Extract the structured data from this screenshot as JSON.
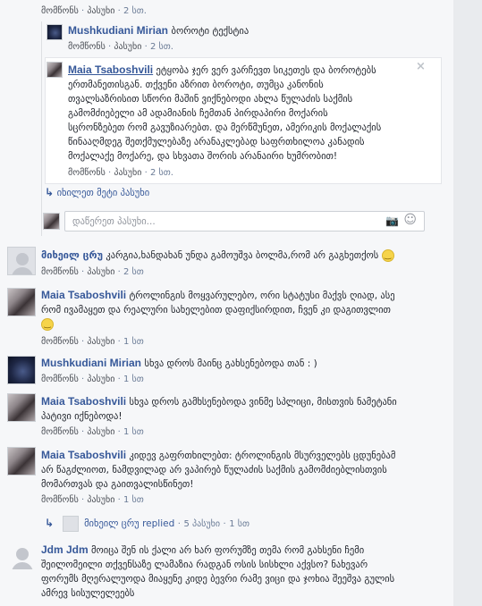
{
  "common": {
    "like": "მომწონს",
    "reply": "პასუხი",
    "dot": "·"
  },
  "top_meta": {
    "time": "2 სთ."
  },
  "reply1": {
    "author": "Mushkudiani Mirian",
    "text": "ბოროტი ტექსტია",
    "time": "2 სთ."
  },
  "reply2": {
    "author": "Maia Tsaboshvili",
    "text": [
      "ეტყობა ჯერ ვერ ვარჩევთ სიკეთეს და ბოროტებს",
      "ერთმანეთისგან. თქვენი აზრით ბოროტი, თუმცა კანონის",
      "თვალსაზრისით სწორი მაშინ ვიქნებოდი ახლა წულაძის საქმის",
      "გამომძიებელი ამ ადამიანის ჩემთან პირდაპირი მოქარის",
      "სცრონზებეთ რომ გავუზიარებთ. და მერწმუნეთ, ამერიკის მოქალაქის",
      "წინააღმდეგ შეთქმულებაზე არანაკლებად საფრთხილოა კანადის",
      "მოქალაქე მოქარე, და სხვათა შორის არანაირი ხუმრობით!"
    ],
    "close": "×",
    "time": "2 სთ."
  },
  "more_replies": "იხილეთ მეტი პასუხი",
  "reply_input": {
    "placeholder": "დაწერეთ პასუხი...",
    "camera": "📷",
    "smile": "☺"
  },
  "c1": {
    "author": "მიხეილ ცრუ",
    "text": [
      "კარგია,ხანდახან უნდა გამოუშვა ბოლმა,რომ არ გაგხეთქოს"
    ],
    "time": "2 სთ"
  },
  "c2": {
    "author": "Maia Tsaboshvili",
    "text": [
      "ტროლინგის მოყვარულებო, ორი სტატუსი მაქვს ღიად, ასე",
      "რომ ივამაყეთ და რეალური სახელებით დაფიქსირდით, ჩვენ კი დაგითვლით"
    ],
    "time": "1 სთ"
  },
  "c3": {
    "author": "Mushkudiani Mirian",
    "text": [
      "სხვა დროს მაინც გახსენებოდა თან : )"
    ],
    "time": "1 სთ"
  },
  "c4": {
    "author": "Maia Tsaboshvili",
    "text": [
      "სხვა დროს გამხსენებოდა ვინმე სპლიცი, მისთვის ნამეტანი",
      "პატივი იქნებოდა!"
    ],
    "time": "1 სთ"
  },
  "c5": {
    "author": "Maia Tsaboshvili",
    "text": [
      "კიდევ გაფრთხილებთ: ტროლინგის მსურველებს ცდუნებამ",
      "არ წაგძლიოთ, ნამდვილად არ ვაპირებ წულაძის საქმის გამომძიებლისთვის",
      "მომართვას და გაითვალისწინეთ!"
    ],
    "time": "1 სთ"
  },
  "c5_replies": {
    "author": "მიხეილ ცრუ",
    "replied": "replied",
    "count": "5 პასუხი",
    "time": "1 სთ"
  },
  "c6": {
    "author": "Jdm Jdm",
    "text": [
      "მოიცა შენ ის ქალი არ ხარ ფორუმზე თემა რომ გახსენი ჩემი",
      "შეილომეილი თქვენსაზე ლამაზია რადგან ოსის სისხლი აქვსო? ნახევარ",
      "ფორუმს მღერალუოდა მიაყენე კიდე ბევრი რამე ვიცი და ჯოხია შეეშვა გულის",
      "ამრევ სისულელეებს"
    ]
  }
}
